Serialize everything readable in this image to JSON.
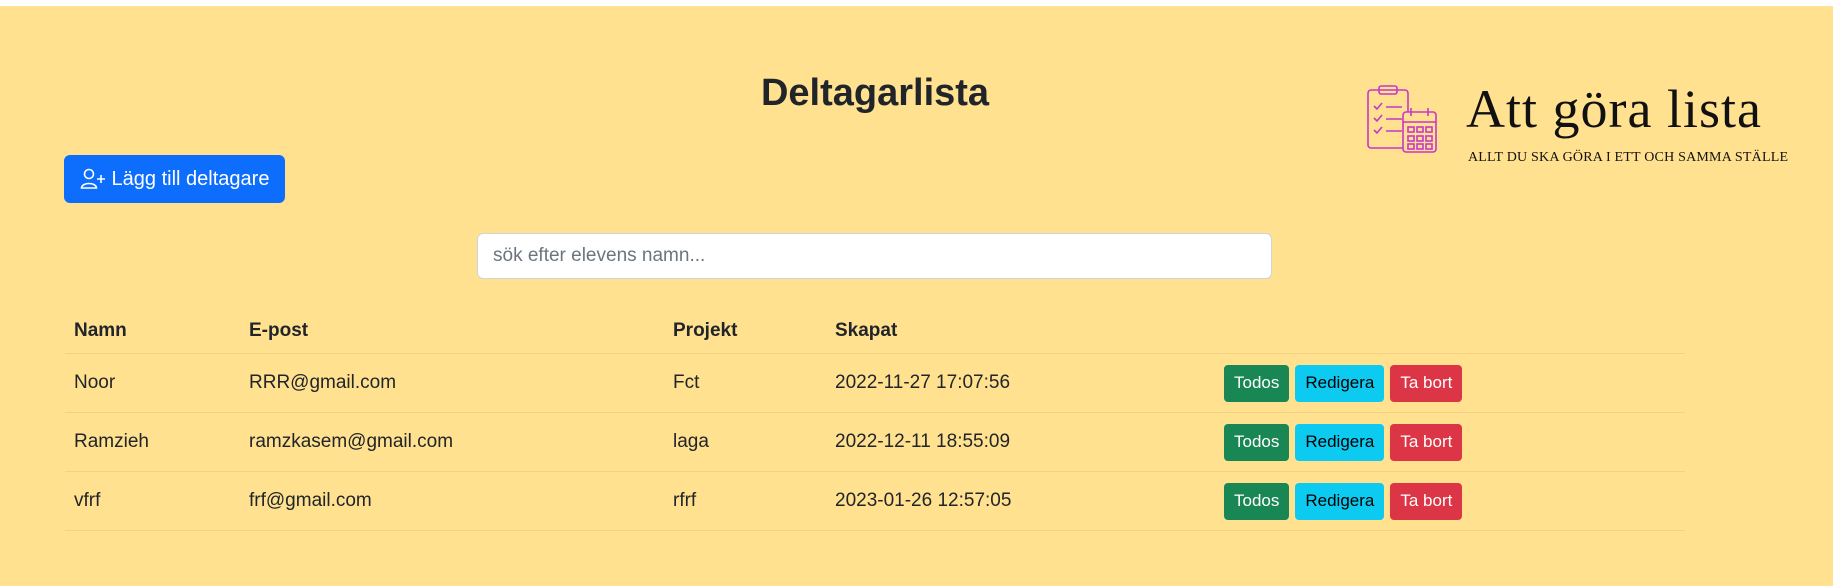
{
  "header": {
    "title": "Deltagarlista",
    "add_button_label": "Lägg till deltagare"
  },
  "logo": {
    "title": "Att göra lista",
    "subtitle": "ALLT DU SKA GÖRA I ETT OCH SAMMA STÄLLE"
  },
  "search": {
    "placeholder": "sök efter elevens namn...",
    "value": ""
  },
  "table": {
    "headers": [
      "Namn",
      "E-post",
      "Projekt",
      "Skapat",
      ""
    ],
    "rows": [
      {
        "name": "Noor",
        "email": "RRR@gmail.com",
        "project": "Fct",
        "created": "2022-11-27 17:07:56"
      },
      {
        "name": "Ramzieh",
        "email": "ramzkasem@gmail.com",
        "project": "laga",
        "created": "2022-12-11 18:55:09"
      },
      {
        "name": "vfrf",
        "email": "frf@gmail.com",
        "project": "rfrf",
        "created": "2023-01-26 12:57:05"
      }
    ],
    "actions": {
      "todos": "Todos",
      "edit": "Redigera",
      "delete": "Ta bort"
    }
  },
  "colors": {
    "background": "#ffe18f",
    "primary": "#0d6efd",
    "success": "#198754",
    "info": "#0dcaf0",
    "danger": "#dc3545",
    "logo_icon": "#c837c8"
  },
  "icons": {
    "add_button": "person-plus-icon",
    "logo": "clipboard-calendar-icon"
  }
}
